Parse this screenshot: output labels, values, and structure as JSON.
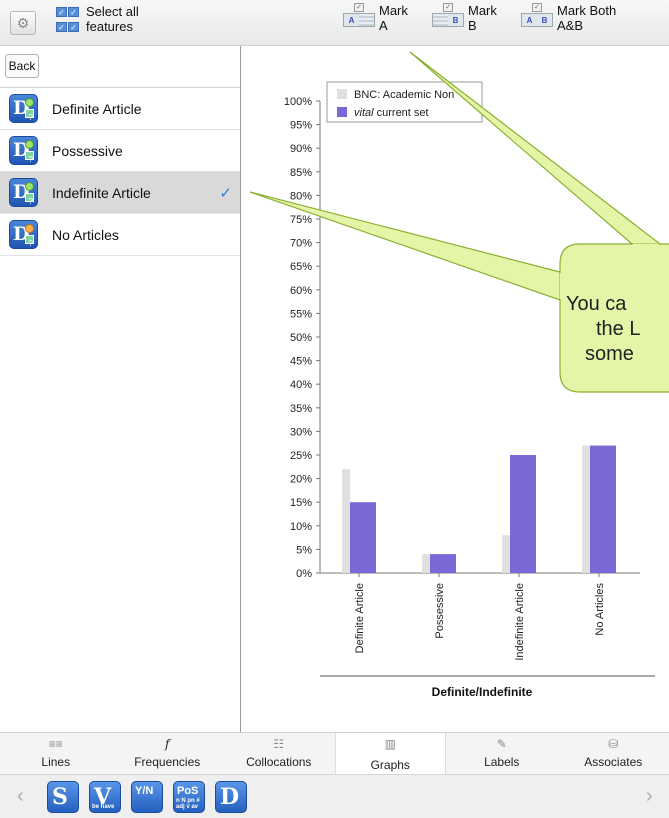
{
  "toolbar": {
    "select_all_line1": "Select all",
    "select_all_line2": "features",
    "mark_a_title": "Mark",
    "mark_a_sub": "A",
    "mark_b_title": "Mark",
    "mark_b_sub": "B",
    "mark_both_title": "Mark Both",
    "mark_both_sub": "A&B",
    "icon_a": "A",
    "icon_b": "B"
  },
  "sidebar": {
    "back_label": "Back",
    "items": [
      {
        "label": "Definite Article",
        "selected": false
      },
      {
        "label": "Possessive",
        "selected": false
      },
      {
        "label": "Indefinite Article",
        "selected": true
      },
      {
        "label": "No Articles",
        "selected": false
      }
    ],
    "check_glyph": "✓"
  },
  "chart_data": {
    "type": "bar",
    "title": "",
    "xlabel": "Definite/Indefinite",
    "ylabel": "",
    "ylim": [
      0,
      100
    ],
    "y_tick_step": 5,
    "y_unit": "%",
    "categories": [
      "Definite Article",
      "Possessive",
      "Indefinite Article",
      "No Articles"
    ],
    "series": [
      {
        "name": "BNC: Academic Non",
        "color": "#e0e0e0",
        "values": [
          22,
          4,
          8,
          27
        ]
      },
      {
        "name": "vital current set",
        "color": "#7b68d6",
        "values": [
          15,
          4,
          25,
          27
        ]
      }
    ],
    "legend": {
      "placement": "top-left",
      "entry1_text": "BNC: Academic Non",
      "entry2_italic": "vital",
      "entry2_text": " current set"
    }
  },
  "callout": {
    "line1": "You ca",
    "line2": "the L",
    "line3": "some",
    "fill": "#e5f5a8",
    "stroke": "#8bb033"
  },
  "tabs": [
    {
      "label": "Lines",
      "icon": "lines-icon",
      "glyph": "≡≡"
    },
    {
      "label": "Frequencies",
      "icon": "f-icon",
      "glyph": "f"
    },
    {
      "label": "Collocations",
      "icon": "collocations-icon",
      "glyph": "☷"
    },
    {
      "label": "Graphs",
      "icon": "graphs-icon",
      "glyph": "▥",
      "active": true
    },
    {
      "label": "Labels",
      "icon": "labels-icon",
      "glyph": "✎"
    },
    {
      "label": "Associates",
      "icon": "associates-icon",
      "glyph": "⛁"
    }
  ],
  "bottombar": {
    "prev": "‹",
    "next": "›",
    "tools": [
      {
        "name": "s-tool-icon",
        "main": "S",
        "sub": ""
      },
      {
        "name": "v-tool-icon",
        "main": "V",
        "sub": "be have"
      },
      {
        "name": "yn-tool-icon",
        "main": "Y/N",
        "sub": ""
      },
      {
        "name": "pos-tool-icon",
        "main": "PoS",
        "sub": "n N pn # adj v av"
      },
      {
        "name": "d-tool-icon",
        "main": "D",
        "sub": ""
      }
    ]
  }
}
